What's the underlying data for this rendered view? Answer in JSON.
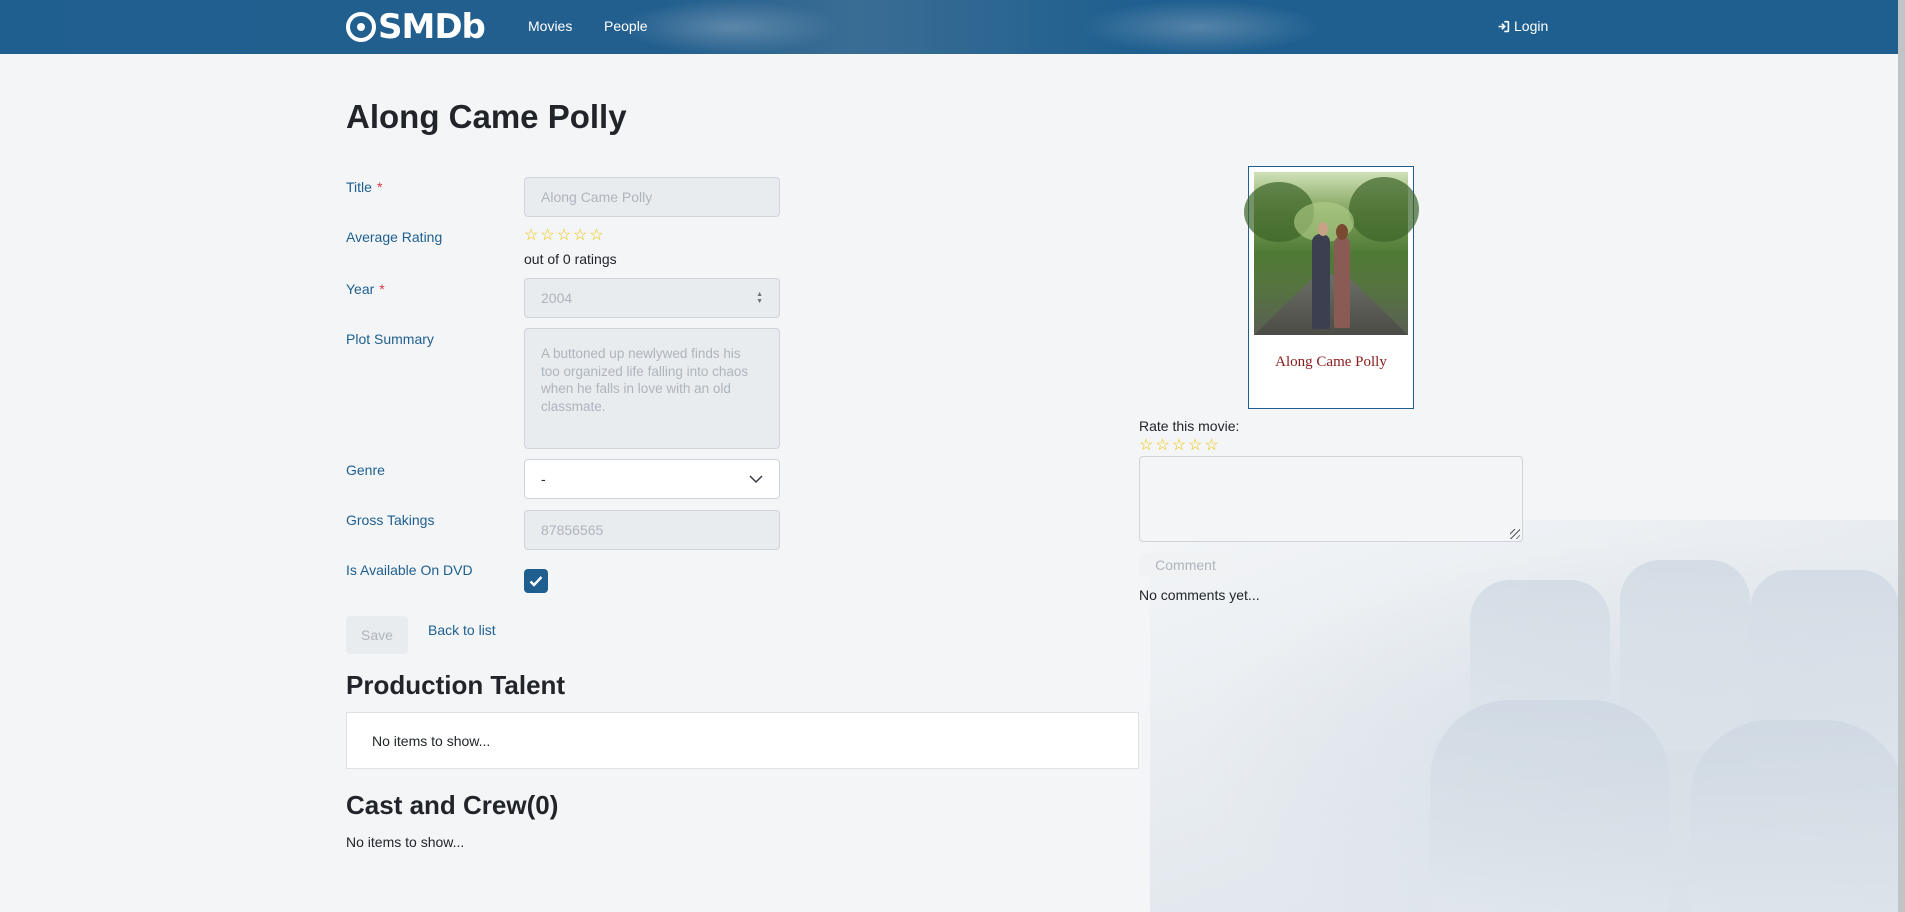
{
  "nav": {
    "logo": "SMDb",
    "links": [
      "Movies",
      "People"
    ],
    "login": "Login"
  },
  "page": {
    "title": "Along Came Polly"
  },
  "form": {
    "title_label": "Title",
    "title_value": "Along Came Polly",
    "rating_label": "Average Rating",
    "rating_text": "out of 0 ratings",
    "year_label": "Year",
    "year_value": "2004",
    "plot_label": "Plot Summary",
    "plot_value": "A buttoned up newlywed finds his too organized life falling into chaos when he falls in love with an old classmate.",
    "genre_label": "Genre",
    "genre_value": "-",
    "gross_label": "Gross Takings",
    "gross_value": "87856565",
    "dvd_label": "Is Available On DVD",
    "dvd_checked": true,
    "required_mark": "*",
    "save_label": "Save",
    "back_label": "Back to list"
  },
  "talent": {
    "heading": "Production Talent",
    "empty": "No items to show..."
  },
  "cast": {
    "heading": "Cast and Crew(0)",
    "empty": "No items to show..."
  },
  "sidebar": {
    "poster_title": "Along Came Polly",
    "rate_label": "Rate this movie:",
    "comment_button": "Comment",
    "no_comments": "No comments yet..."
  },
  "colors": {
    "brand": "#1f5f8f",
    "star": "#f0c400",
    "required": "#dc3545"
  }
}
